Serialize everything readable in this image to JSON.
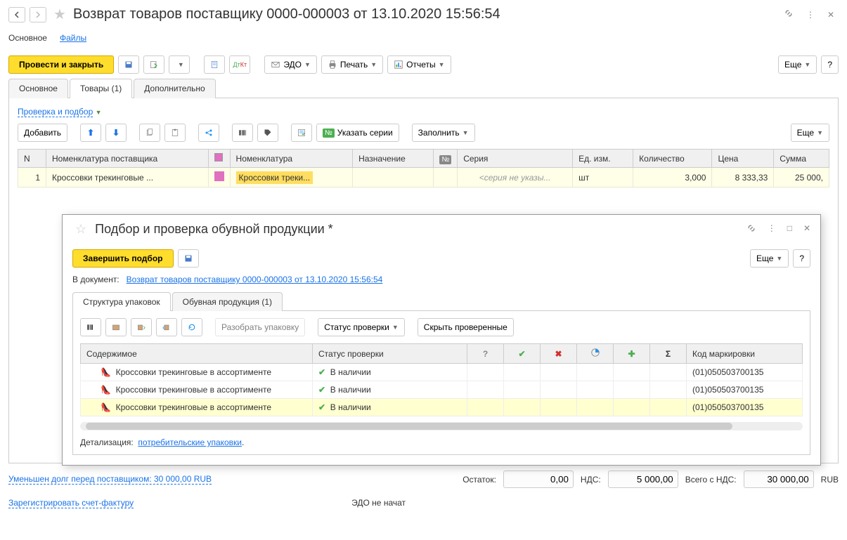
{
  "header": {
    "title": "Возврат товаров поставщику 0000-000003 от 13.10.2020 15:56:54"
  },
  "subnav": {
    "main": "Основное",
    "files": "Файлы"
  },
  "toolbar": {
    "post_and_close": "Провести и закрыть",
    "edo": "ЭДО",
    "print": "Печать",
    "reports": "Отчеты",
    "more": "Еще",
    "help": "?"
  },
  "tabs": {
    "main": "Основное",
    "goods": "Товары (1)",
    "additional": "Дополнительно"
  },
  "goods_panel": {
    "check_link": "Проверка и подбор",
    "add": "Добавить",
    "set_series": "Указать серии",
    "fill": "Заполнить",
    "more": "Еще"
  },
  "table": {
    "headers": {
      "n": "N",
      "supplier_nom": "Номенклатура поставщика",
      "nom": "Номенклатура",
      "purpose": "Назначение",
      "series": "Серия",
      "unit": "Ед. изм.",
      "qty": "Количество",
      "price": "Цена",
      "sum": "Сумма"
    },
    "rows": [
      {
        "n": "1",
        "supplier_nom": "Кроссовки трекинговые ...",
        "nom": "Кроссовки треки...",
        "series": "<серия не указы...",
        "unit": "шт",
        "qty": "3,000",
        "price": "8 333,33",
        "sum": "25 000,"
      }
    ]
  },
  "modal": {
    "title": "Подбор и проверка обувной продукции *",
    "finish": "Завершить подбор",
    "more": "Еще",
    "help": "?",
    "doc_label": "В документ:",
    "doc_link": "Возврат товаров поставщику 0000-000003 от 13.10.2020 15:56:54",
    "tabs": {
      "structure": "Структура упаковок",
      "shoes": "Обувная продукция (1)"
    },
    "inner_toolbar": {
      "unpack": "Разобрать упаковку",
      "status": "Статус проверки",
      "hide_checked": "Скрыть проверенные"
    },
    "inner_table": {
      "headers": {
        "content": "Содержимое",
        "status": "Статус проверки",
        "marking": "Код маркировки"
      },
      "rows": [
        {
          "content": "Кроссовки трекинговые в ассортименте",
          "status": "В наличии",
          "marking": "(01)050503700135"
        },
        {
          "content": "Кроссовки трекинговые в ассортименте",
          "status": "В наличии",
          "marking": "(01)050503700135"
        },
        {
          "content": "Кроссовки трекинговые в ассортименте",
          "status": "В наличии",
          "marking": "(01)050503700135"
        }
      ]
    },
    "detail_label": "Детализация:",
    "detail_link": "потребительские упаковки"
  },
  "footer": {
    "debt_link": "Уменьшен долг перед поставщиком: 30 000,00 RUB",
    "remainder_label": "Остаток:",
    "remainder": "0,00",
    "vat_label": "НДС:",
    "vat": "5 000,00",
    "total_label": "Всего с НДС:",
    "total": "30 000,00",
    "currency": "RUB",
    "register_invoice": "Зарегистрировать счет-фактуру",
    "edo_status": "ЭДО не начат"
  }
}
